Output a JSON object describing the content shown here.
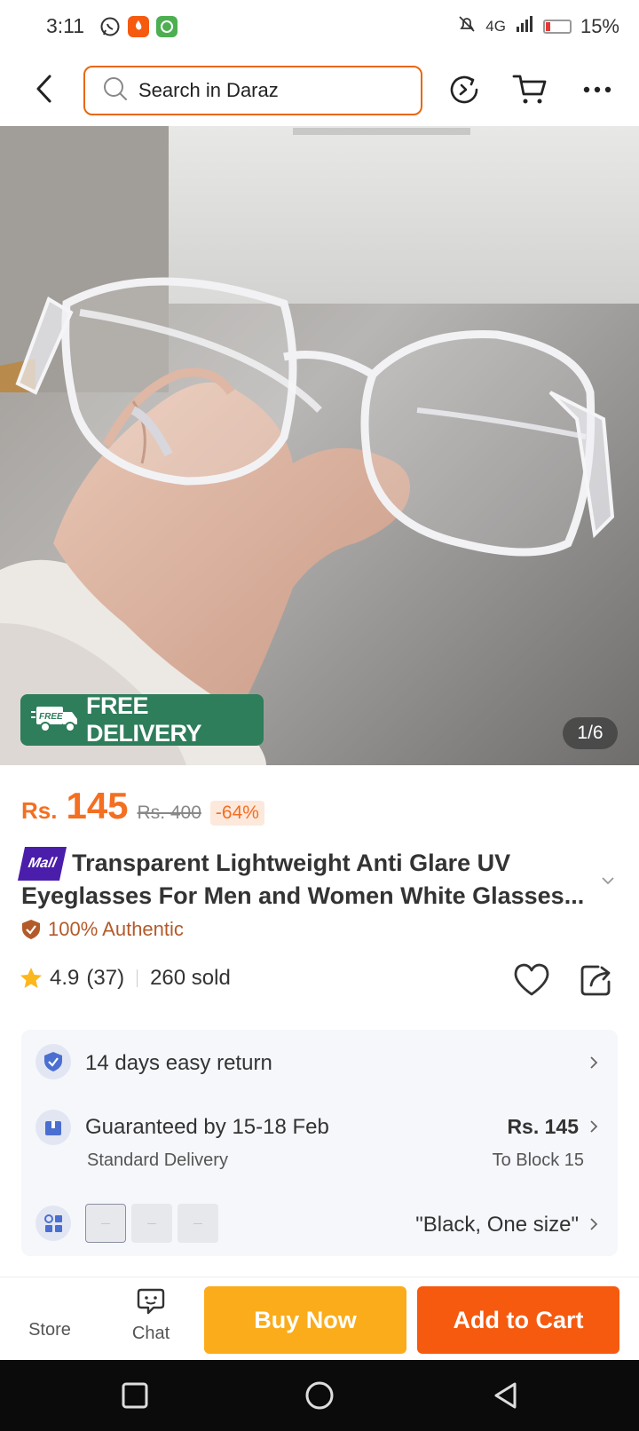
{
  "status_bar": {
    "time": "3:11",
    "network": "4G",
    "battery": "15%"
  },
  "header": {
    "search_placeholder": "Search in Daraz"
  },
  "gallery": {
    "counter": "1/6",
    "badge_small": "FREE",
    "badge_text": "FREE DELIVERY"
  },
  "price": {
    "currency": "Rs.",
    "current": "145",
    "original": "Rs. 400",
    "discount": "-64%"
  },
  "product": {
    "mall_label": "Mall",
    "title": "Transparent Lightweight Anti Glare UV Eyeglasses For Men and Women White Glasses...",
    "authentic": "100% Authentic"
  },
  "rating": {
    "score": "4.9",
    "count": "(37)",
    "sold": "260 sold"
  },
  "info": {
    "returns": "14 days easy return",
    "delivery_main": "Guaranteed by 15-18 Feb",
    "delivery_sub": "Standard Delivery",
    "delivery_price": "Rs. 145",
    "delivery_location": "To Block 15",
    "variant_selected": "\"Black, One size\""
  },
  "actions": {
    "store": "Store",
    "chat": "Chat",
    "buy_now": "Buy Now",
    "add_to_cart": "Add to Cart"
  },
  "colors": {
    "accent": "#f36f21",
    "buy_now": "#fbac1b",
    "add_to_cart": "#f55a0f",
    "free_badge": "#2e7d5b",
    "mall": "#4b1dab"
  }
}
